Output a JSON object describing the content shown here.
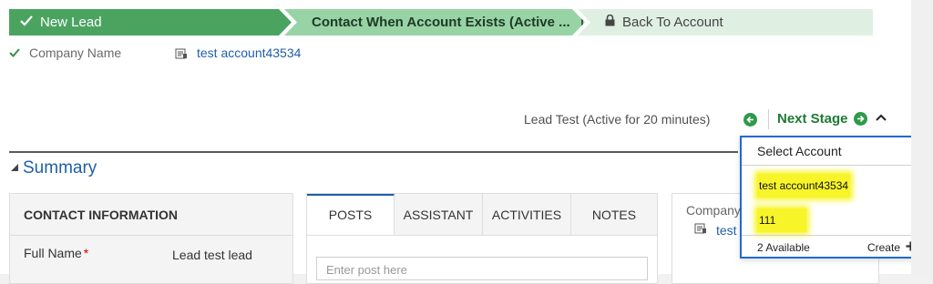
{
  "process": {
    "stages": [
      {
        "label": "New Lead",
        "icon": "check-icon",
        "state": "completed"
      },
      {
        "label": "Contact When Account Exists (Active ...",
        "icon": "flag-icon",
        "state": "active"
      },
      {
        "label": "Back To Account",
        "icon": "lock-icon",
        "state": "locked"
      }
    ],
    "step": {
      "label": "Company Name",
      "value": "test account43534"
    }
  },
  "header": {
    "record_status": "Lead Test (Active for 20 minutes)",
    "next_stage_label": "Next Stage"
  },
  "summary": {
    "title": "Summary"
  },
  "contact": {
    "header": "CONTACT INFORMATION",
    "full_name_label": "Full Name",
    "required_mark": "*",
    "full_name_value": "Lead test lead"
  },
  "tabs": {
    "items": [
      "POSTS",
      "ASSISTANT",
      "ACTIVITIES",
      "NOTES"
    ],
    "post_placeholder": "Enter post here"
  },
  "right_panel": {
    "company_label": "Company",
    "company_value": "test"
  },
  "flyout": {
    "title": "Select Account",
    "items": [
      "test account43534",
      "111"
    ],
    "count_text": "2 Available",
    "create_label": "Create"
  },
  "colors": {
    "completed_stage": "#4aa460",
    "active_stage": "#98d3a6",
    "locked_stage": "#dff0e3",
    "link": "#1f5fa8",
    "flyout_border": "#1f6bd1",
    "highlight": "#f7f52a"
  }
}
